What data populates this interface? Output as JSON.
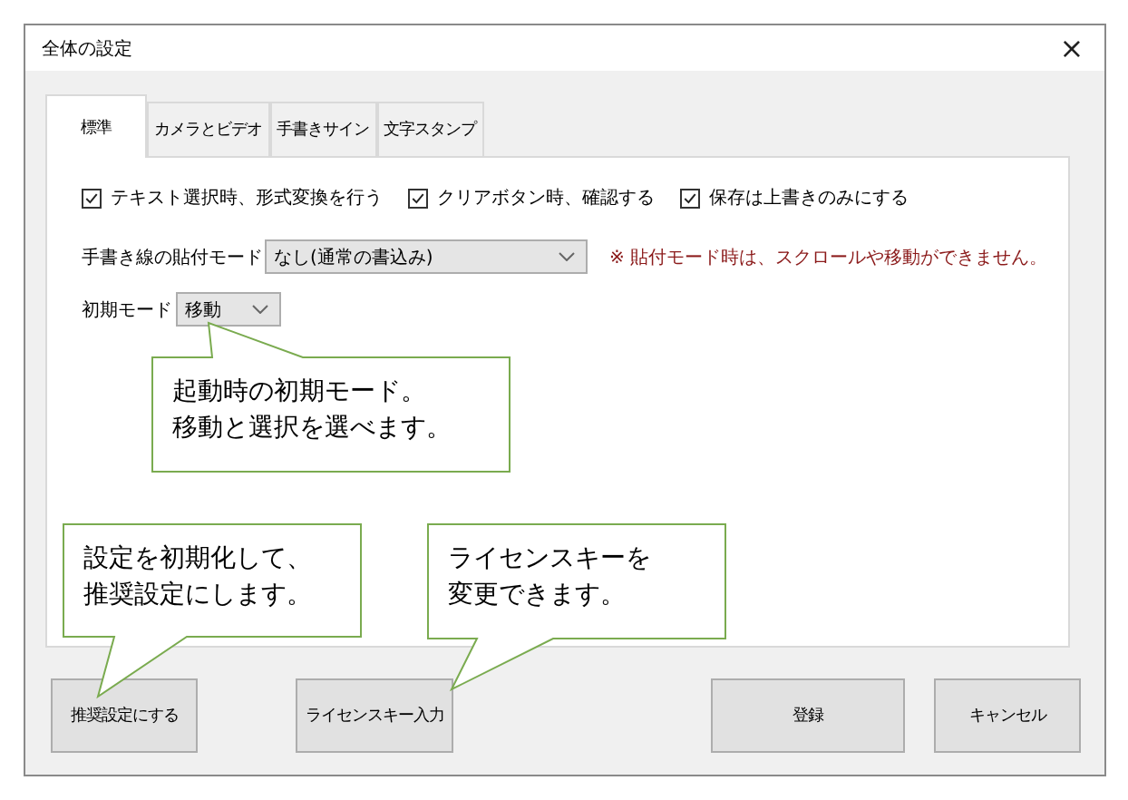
{
  "window": {
    "title": "全体の設定",
    "close": "×"
  },
  "tabs": [
    {
      "label": "標準",
      "selected": true
    },
    {
      "label": "カメラとビデオ",
      "selected": false
    },
    {
      "label": "手書きサイン",
      "selected": false
    },
    {
      "label": "文字スタンプ",
      "selected": false
    }
  ],
  "checkboxes": [
    {
      "label": "テキスト選択時、形式変換を行う",
      "checked": true
    },
    {
      "label": "クリアボタン時、確認する",
      "checked": true
    },
    {
      "label": "保存は上書きのみにする",
      "checked": true
    }
  ],
  "paste_mode": {
    "label": "手書き線の貼付モード",
    "value": "なし(通常の書込み)",
    "note": "※ 貼付モード時は、スクロールや移動ができません。"
  },
  "initial_mode": {
    "label": "初期モード",
    "value": "移動"
  },
  "callouts": [
    {
      "lines": [
        "起動時の初期モード。",
        "移動と選択を選べます。"
      ]
    },
    {
      "lines": [
        "設定を初期化して、",
        "推奨設定にします。"
      ]
    },
    {
      "lines": [
        "ライセンスキーを",
        "変更できます。"
      ]
    }
  ],
  "buttons": [
    "推奨設定にする",
    "ライセンスキー入力",
    "登録",
    "キャンセル"
  ]
}
